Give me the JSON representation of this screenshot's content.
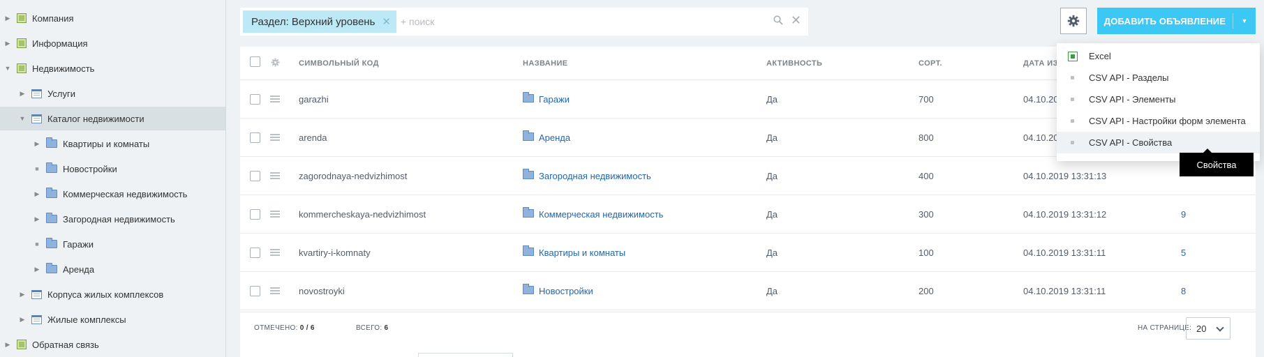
{
  "sidebar": {
    "items": [
      {
        "label": "Компания"
      },
      {
        "label": "Информация"
      },
      {
        "label": "Недвижимость"
      },
      {
        "label": "Услуги"
      },
      {
        "label": "Каталог недвижимости"
      },
      {
        "label": "Квартиры и комнаты"
      },
      {
        "label": "Новостройки"
      },
      {
        "label": "Коммерческая недвижимость"
      },
      {
        "label": "Загородная недвижимость"
      },
      {
        "label": "Гаражи"
      },
      {
        "label": "Аренда"
      },
      {
        "label": "Корпуса жилых комплексов"
      },
      {
        "label": "Жилые комплексы"
      },
      {
        "label": "Обратная связь"
      }
    ]
  },
  "filter": {
    "chip_label": "Раздел: Верхний уровень",
    "placeholder": "+ поиск"
  },
  "toolbar": {
    "add_label": "ДОБАВИТЬ ОБЪЯВЛЕНИЕ"
  },
  "grid": {
    "columns": {
      "code": "СИМВОЛЬНЫЙ КОД",
      "name": "НАЗВАНИЕ",
      "active": "АКТИВНОСТЬ",
      "sort": "СОРТ.",
      "date": "ДАТА ИЗ"
    },
    "rows": [
      {
        "code": "garazhi",
        "name": "Гаражи",
        "active": "Да",
        "sort": "700",
        "date": "04.10.20",
        "count": ""
      },
      {
        "code": "arenda",
        "name": "Аренда",
        "active": "Да",
        "sort": "800",
        "date": "04.10.20",
        "count": ""
      },
      {
        "code": "zagorodnaya-nedvizhimost",
        "name": "Загородная недвижимость",
        "active": "Да",
        "sort": "400",
        "date": "04.10.2019 13:31:13",
        "count": ""
      },
      {
        "code": "kommercheskaya-nedvizhimost",
        "name": "Коммерческая недвижимость",
        "active": "Да",
        "sort": "300",
        "date": "04.10.2019 13:31:12",
        "count": "9"
      },
      {
        "code": "kvartiry-i-komnaty",
        "name": "Квартиры и комнаты",
        "active": "Да",
        "sort": "100",
        "date": "04.10.2019 13:31:11",
        "count": "5"
      },
      {
        "code": "novostroyki",
        "name": "Новостройки",
        "active": "Да",
        "sort": "200",
        "date": "04.10.2019 13:31:11",
        "count": "8"
      }
    ],
    "footer": {
      "marked_label": "ОТМЕЧЕНО:",
      "marked_value": "0 / 6",
      "total_label": "ВСЕГО:",
      "total_value": "6",
      "per_page_label": "НА СТРАНИЦЕ:",
      "per_page_value": "20"
    }
  },
  "menu": {
    "items": [
      {
        "label": "Excel",
        "icon": "excel-icon"
      },
      {
        "label": "CSV API - Разделы"
      },
      {
        "label": "CSV API - Элементы"
      },
      {
        "label": "CSV API - Настройки форм элемента"
      },
      {
        "label": "CSV API - Свойства"
      }
    ],
    "tooltip": "Свойства"
  },
  "colors": {
    "accent": "#3bc8f5",
    "link": "#2067b0",
    "chip": "#bde8f6"
  }
}
